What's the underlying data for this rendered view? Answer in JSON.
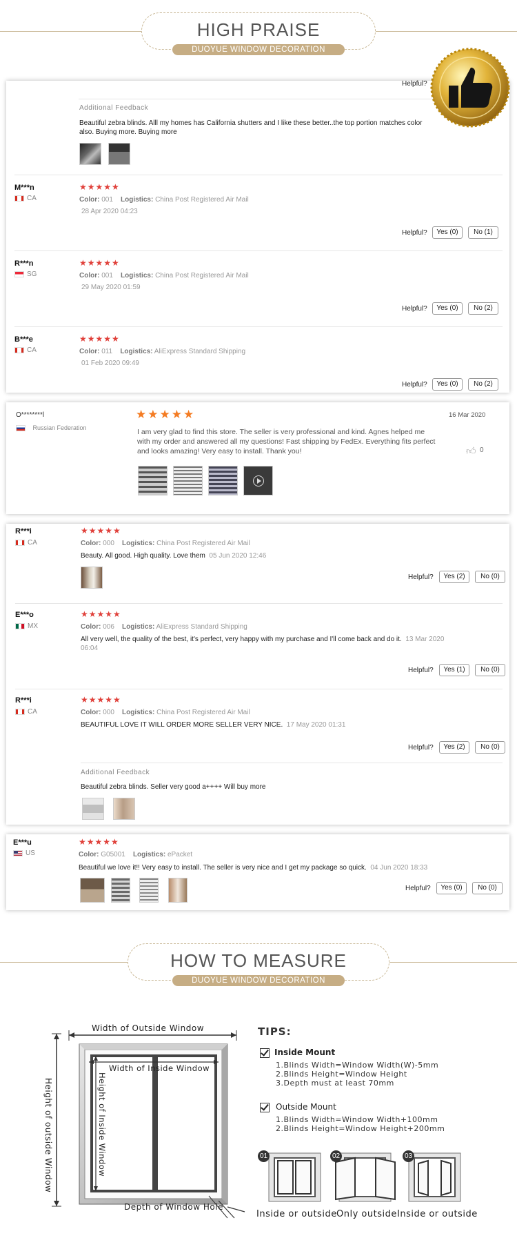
{
  "header1": {
    "title": "HIGH PRAISE",
    "ribbon": "DUOYUE WINDOW DECORATION"
  },
  "header2": {
    "title": "HOW TO MEASURE",
    "ribbon": "DUOYUE WINDOW DECORATION"
  },
  "helpful_label": "Helpful?",
  "card1": {
    "top_helpful": "Helpful?",
    "additional_feedback_label": "Additional Feedback",
    "additional_feedback_text": "Beautiful zebra blinds. Alll my homes has California shutters and I like these better..the top portion matches color also. Buying more. Buying more",
    "reviews": [
      {
        "user": "M***n",
        "country": "CA",
        "stars": "★★★★★",
        "color_label": "Color:",
        "color": "001",
        "logistics_label": "Logistics:",
        "logistics": "China Post Registered Air Mail",
        "date": "28 Apr 2020 04:23",
        "yes": "Yes (0)",
        "no": "No (1)"
      },
      {
        "user": "R***n",
        "country": "SG",
        "stars": "★★★★★",
        "color_label": "Color:",
        "color": "001",
        "logistics_label": "Logistics:",
        "logistics": "China Post Registered Air Mail",
        "date": "29 May 2020 01:59",
        "yes": "Yes (0)",
        "no": "No (2)"
      },
      {
        "user": "B***e",
        "country": "CA",
        "stars": "★★★★★",
        "color_label": "Color:",
        "color": "011",
        "logistics_label": "Logistics:",
        "logistics": "AliExpress Standard Shipping",
        "date": "01 Feb 2020 09:49",
        "yes": "Yes (0)",
        "no": "No (2)"
      }
    ]
  },
  "card2": {
    "user": "O********l",
    "country": "Russian Federation",
    "stars": "★★★★★",
    "date": "16 Mar 2020",
    "text": "I am very glad to find this store.  The seller is very professional and kind.  Agnes helped me with my order and answered all my questions! Fast shipping by FedEx. Everything fits perfect and looks amazing! Very easy to install.  Thank you!",
    "likes": "0"
  },
  "card3": {
    "reviews": [
      {
        "user": "R***i",
        "country": "CA",
        "stars": "★★★★★",
        "color_label": "Color:",
        "color": "000",
        "logistics_label": "Logistics:",
        "logistics": "China Post Registered Air Mail",
        "text": "Beauty. All good. High quality. Love them",
        "date": "05 Jun 2020 12:46",
        "yes": "Yes (2)",
        "no": "No (0)"
      },
      {
        "user": "E***o",
        "country": "MX",
        "stars": "★★★★★",
        "color_label": "Color:",
        "color": "006",
        "logistics_label": "Logistics:",
        "logistics": "AliExpress Standard Shipping",
        "text": "All very well, the quality of the best, it's perfect, very happy with my purchase and I'll come back and do it.",
        "date": "13 Mar 2020",
        "date2": "06:04",
        "yes": "Yes (1)",
        "no": "No (0)"
      },
      {
        "user": "R***i",
        "country": "CA",
        "stars": "★★★★★",
        "color_label": "Color:",
        "color": "000",
        "logistics_label": "Logistics:",
        "logistics": "China Post Registered Air Mail",
        "text": "BEAUTIFUL LOVE IT WILL ORDER MORE SELLER VERY NICE.",
        "date": "17 May 2020 01:31",
        "yes": "Yes (2)",
        "no": "No (0)"
      }
    ],
    "additional_feedback_label": "Additional Feedback",
    "additional_feedback_text": "Beautiful zebra blinds. Seller very good a++++ Will buy more"
  },
  "card4": {
    "user": "E***u",
    "country": "US",
    "stars": "★★★★★",
    "color_label": "Color:",
    "color": "G05001",
    "logistics_label": "Logistics:",
    "logistics": "ePacket",
    "text": "Beautiful we love it!! Very easy to install. The seller is very nice and I get my package so quick.",
    "date": "04 Jun 2020 18:33",
    "yes": "Yes (0)",
    "no": "No (0)"
  },
  "measure": {
    "width_outside": "Width of Outside Window",
    "width_inside": "Width of Inside Window",
    "height_outside": "Height of outside Window",
    "height_inside": "Height of Inside Window",
    "depth": "Depth of Window Hole",
    "tips_title": "TIPS:",
    "inside_mount": "Inside Mount",
    "inside_items": [
      "1.Blinds Width=Window Width(W)-5mm",
      "2.Blinds Height=Window Height",
      "3.Depth must at least 70mm"
    ],
    "outside_mount": "Outside Mount",
    "outside_items": [
      "1.Blinds Width=Window Width+100mm",
      "2.Blinds Height=Window Height+200mm"
    ],
    "diagrams": [
      {
        "num": "01",
        "caption": "Inside or outside"
      },
      {
        "num": "02",
        "caption": "Only outside"
      },
      {
        "num": "03",
        "caption": "Inside or outside"
      }
    ]
  }
}
